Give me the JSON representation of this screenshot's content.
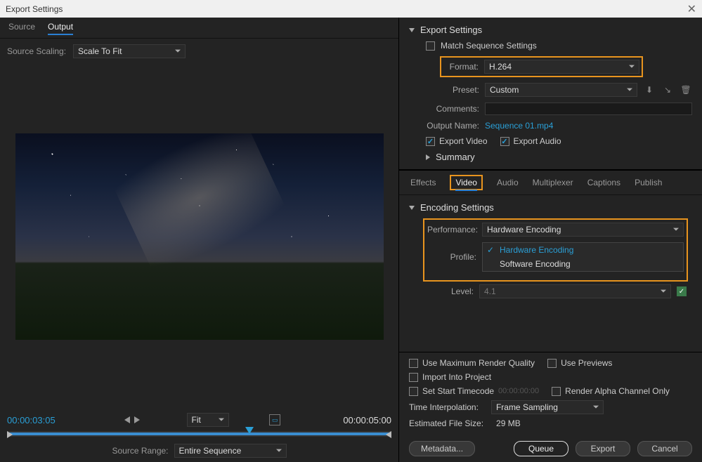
{
  "window": {
    "title": "Export Settings"
  },
  "preview": {
    "tabs": {
      "source": "Source",
      "output": "Output"
    },
    "scaling_label": "Source Scaling:",
    "scaling_value": "Scale To Fit",
    "timecode": "00:00:03:05",
    "fit_label": "Fit",
    "duration": "00:00:05:00",
    "range_label": "Source Range:",
    "range_value": "Entire Sequence"
  },
  "export": {
    "header": "Export Settings",
    "match_seq": "Match Sequence Settings",
    "format_label": "Format:",
    "format_value": "H.264",
    "preset_label": "Preset:",
    "preset_value": "Custom",
    "comments_label": "Comments:",
    "output_name_label": "Output Name:",
    "output_name_value": "Sequence 01.mp4",
    "export_video": "Export Video",
    "export_audio": "Export Audio",
    "summary": "Summary"
  },
  "tabs": {
    "effects": "Effects",
    "video": "Video",
    "audio": "Audio",
    "multiplexer": "Multiplexer",
    "captions": "Captions",
    "publish": "Publish"
  },
  "encoding": {
    "header": "Encoding Settings",
    "perf_label": "Performance:",
    "perf_value": "Hardware Encoding",
    "options": {
      "hw": "Hardware Encoding",
      "sw": "Software Encoding"
    },
    "profile_label": "Profile:",
    "level_label": "Level:",
    "level_value": "4.1"
  },
  "bottom": {
    "max_quality": "Use Maximum Render Quality",
    "use_previews": "Use Previews",
    "import_project": "Import Into Project",
    "start_tc": "Set Start Timecode",
    "start_tc_value": "00:00:00:00",
    "render_alpha": "Render Alpha Channel Only",
    "time_interp_label": "Time Interpolation:",
    "time_interp_value": "Frame Sampling",
    "est_label": "Estimated File Size:",
    "est_value": "29 MB"
  },
  "buttons": {
    "metadata": "Metadata...",
    "queue": "Queue",
    "export": "Export",
    "cancel": "Cancel"
  }
}
